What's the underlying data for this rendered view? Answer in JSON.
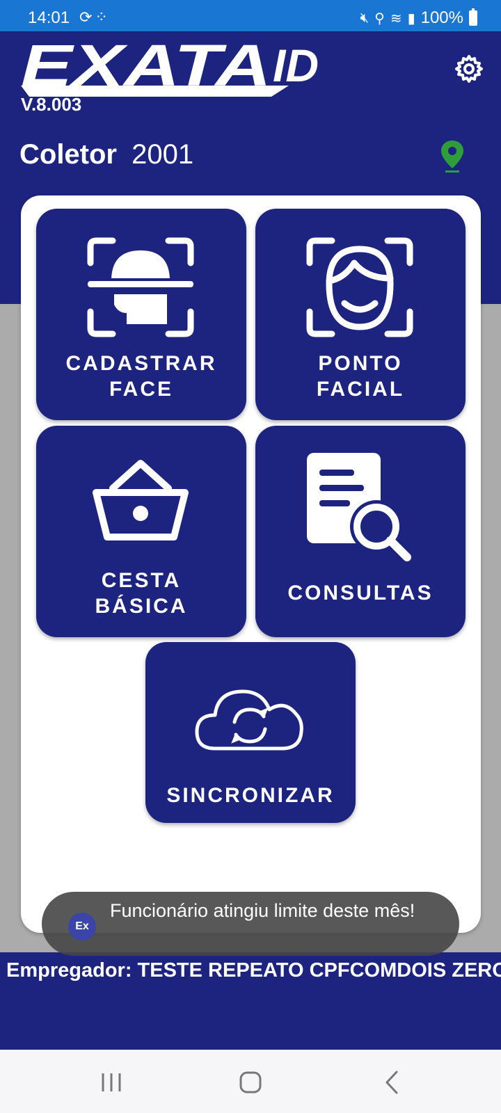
{
  "status_bar": {
    "time": "14:01",
    "left_icons": [
      "sync-status-icon",
      "apps-icon"
    ],
    "right_icons": [
      "mute-icon",
      "location-icon",
      "wifi-icon",
      "signal-icon",
      "battery-icon"
    ],
    "battery": "100%"
  },
  "header": {
    "logo_text": "EXATA",
    "logo_suffix": "ID",
    "version": "V.8.003",
    "coletor_label": "Coletor",
    "coletor_value": "2001",
    "settings_icon": "gear-icon",
    "location_icon": "location-pin-icon"
  },
  "tiles": [
    {
      "label": "CADASTRAR\nFACE",
      "icon": "face-register-icon"
    },
    {
      "label": "PONTO\nFACIAL",
      "icon": "face-scan-icon"
    },
    {
      "label": "CESTA\nBÁSICA",
      "icon": "basket-icon"
    },
    {
      "label": "CONSULTAS",
      "icon": "document-search-icon"
    },
    {
      "label": "SINCRONIZAR",
      "icon": "cloud-sync-icon"
    }
  ],
  "footer": {
    "empregador": "Empregador: TESTE REPEATO CPFCOMDOIS ZERO"
  },
  "toast": {
    "icon_text": "Ex",
    "message": "Funcionário atingiu limite deste mês!"
  },
  "nav": [
    "recent-apps-icon",
    "home-icon",
    "back-icon"
  ],
  "colors": {
    "primary": "#1c2480",
    "status_bar": "#1976d2",
    "location_pin": "#2e9e3a"
  }
}
